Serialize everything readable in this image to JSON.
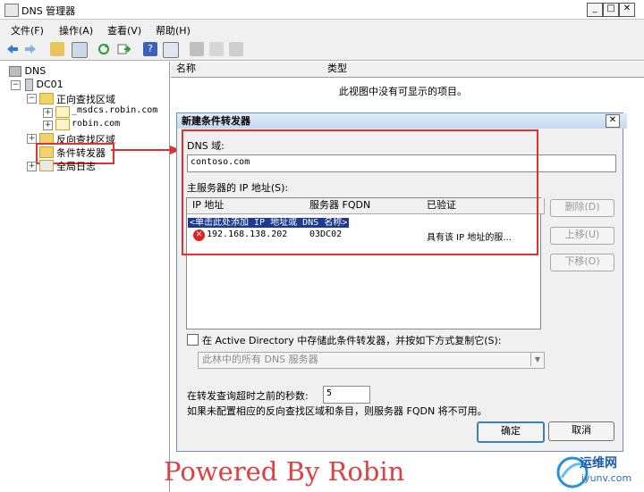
{
  "window": {
    "title": "DNS 管理器"
  },
  "menu": [
    "文件(F)",
    "操作(A)",
    "查看(V)",
    "帮助(H)"
  ],
  "tree": {
    "root": "DNS",
    "server": "DC01",
    "forward_zones": "正向查找区域",
    "zone1": "_msdcs.robin.com",
    "zone2": "robin.com",
    "reverse_zones": "反向查找区域",
    "conditional_forwarders": "条件转发器",
    "global_logs": "全局日志"
  },
  "list": {
    "columns": [
      "名称",
      "类型"
    ],
    "empty_text": "此视图中没有可显示的项目。"
  },
  "dialog": {
    "title": "新建条件转发器",
    "dns_domain_label": "DNS 域:",
    "dns_domain_value": "contoso.com",
    "master_ip_label": "主服务器的 IP 地址(S):",
    "columns": [
      "IP 地址",
      "服务器 FQDN",
      "已验证"
    ],
    "new_row_placeholder": "<单击此处添加 IP 地址或 DNS 名称>",
    "rows": [
      {
        "ip": "192.168.138.202",
        "fqdn": "03DC02",
        "verified": "具有该 IP 地址的服..."
      }
    ],
    "buttons": {
      "delete": "删除(D)",
      "up": "上移(U)",
      "down": "下移(O)",
      "ok": "确定",
      "cancel": "取消"
    },
    "store_ad_label": "在 Active Directory 中存储此条件转发器，并按如下方式复制它(S):",
    "replication_value": "此林中的所有 DNS 服务器",
    "timeout_label": "在转发查询超时之前的秒数:",
    "timeout_value": "5",
    "note": "如果未配置相应的反向查找区域和条目，则服务器 FQDN 将不可用。"
  },
  "watermark": "Powered By Robin",
  "brand": {
    "cn": "运维网",
    "en": "iyunv.com"
  },
  "colors": {
    "annotation_red": "#e03030",
    "selection_blue": "#1c3b8c",
    "title_gradient": "#c6d8ee"
  }
}
